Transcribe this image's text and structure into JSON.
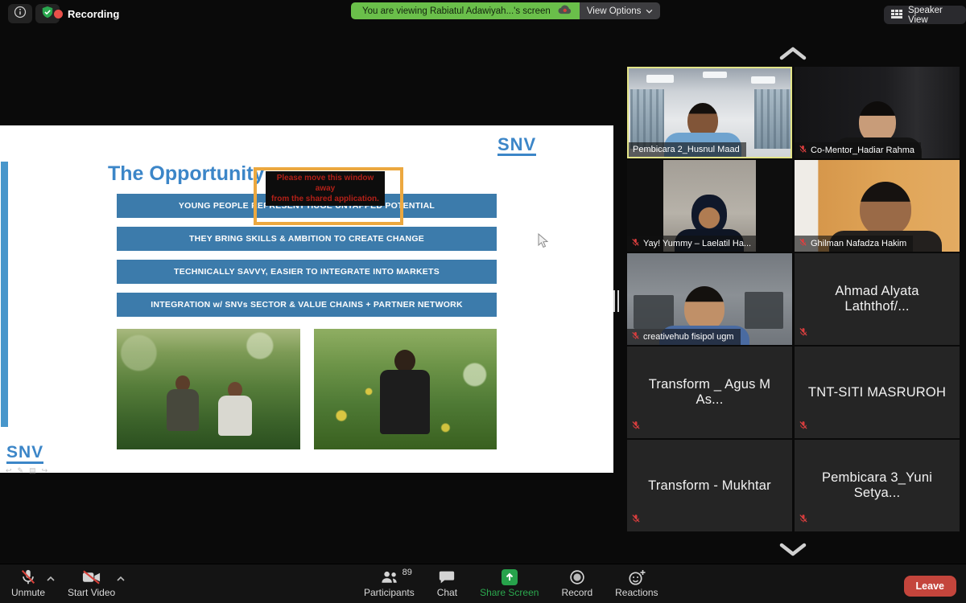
{
  "top_bar": {
    "recording_label": "Recording",
    "banner_text": "You are viewing Rabiatul Adawiyah...'s screen",
    "view_options_label": "View Options",
    "speaker_view_label": "Speaker View"
  },
  "slide": {
    "logo_top": "SNV",
    "logo_bottom": "SNV",
    "title": "The Opportunity",
    "warning_line1": "Please move this window away",
    "warning_line2": "from the shared application.",
    "bars": [
      "YOUNG PEOPLE REPRESENT HUGE UNTAPPED POTENTIAL",
      "THEY BRING SKILLS & AMBITION TO CREATE CHANGE",
      "TECHNICALLY SAVVY, EASIER TO INTEGRATE INTO MARKETS",
      "INTEGRATION w/ SNVs SECTOR & VALUE CHAINS + PARTNER NETWORK"
    ],
    "photos": [
      "two-farmers-in-green-cassava-field",
      "woman-in-dark-top-among-okra-plants"
    ]
  },
  "participants_panel": {
    "tiles": [
      {
        "name": "Pembicara 2_Husnul Maad",
        "video": true,
        "muted": false,
        "active_speaker": true
      },
      {
        "name": "Co-Mentor_Hadiar Rahma",
        "video": true,
        "muted": true
      },
      {
        "name": "Yay! Yummy – Laelatil Ha...",
        "video": true,
        "muted": true
      },
      {
        "name": "Ghilman Nafadza Hakim",
        "video": true,
        "muted": true
      },
      {
        "name": "creativehub fisipol ugm",
        "video": true,
        "muted": true
      },
      {
        "name": "Ahmad Alyata Laththof/...",
        "video": false,
        "muted": true
      },
      {
        "name": "Transform _ Agus M As...",
        "video": false,
        "muted": true
      },
      {
        "name": "TNT-SITI MASRUROH",
        "video": false,
        "muted": true
      },
      {
        "name": "Transform - Mukhtar",
        "video": false,
        "muted": true
      },
      {
        "name": "Pembicara 3_Yuni Setya...",
        "video": false,
        "muted": true
      }
    ]
  },
  "toolbar": {
    "unmute_label": "Unmute",
    "start_video_label": "Start Video",
    "participants_label": "Participants",
    "participants_count": "89",
    "chat_label": "Chat",
    "share_screen_label": "Share Screen",
    "record_label": "Record",
    "reactions_label": "Reactions",
    "leave_label": "Leave"
  },
  "icons": {
    "info-icon": "circled-i",
    "security-shield-icon": "green-shield-check",
    "recording-dot": "red-dot",
    "cloud-recording-icon": "cloud-with-red-dot",
    "speaker-view-icon": "grid",
    "muted-mic-icon": "red-slashed-microphone",
    "camera-off-icon": "slashed-camera",
    "participants-icon": "two-people",
    "chat-icon": "speech-bubble",
    "share-screen-icon": "green-square-up-arrow",
    "record-icon": "circle",
    "reactions-icon": "smiley-plus",
    "scroll-up-icon": "chevron-up",
    "scroll-down-icon": "chevron-down"
  },
  "colors": {
    "banner_green": "#6abf4a",
    "share_green": "#27a24b",
    "leave_red": "#c4453c",
    "slide_blue": "#3c7bab",
    "slide_accent_blue": "#3c86c8",
    "warning_orange": "#eca83f",
    "active_speaker_border": "#e3e487",
    "muted_red": "#d7413a"
  }
}
